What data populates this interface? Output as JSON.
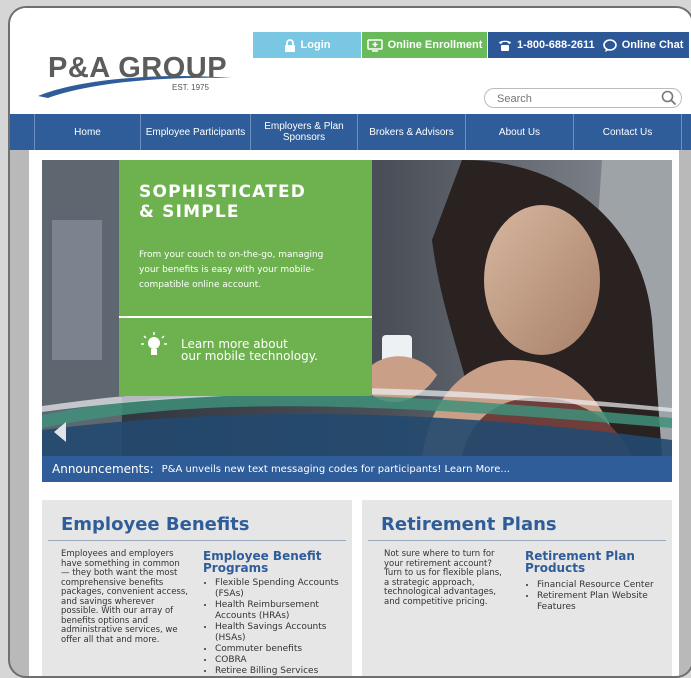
{
  "header": {
    "logo_text": "P&A GROUP",
    "logo_est": "EST. 1975",
    "login_label": "Login",
    "enroll_label": "Online Enrollment",
    "phone_label": "1-800-688-2611",
    "chat_label": "Online Chat",
    "search_placeholder": "Search"
  },
  "nav": {
    "items": [
      {
        "label": "Home"
      },
      {
        "label": "Employee Participants"
      },
      {
        "label": "Employers & Plan Sponsors"
      },
      {
        "label": "Brokers & Advisors"
      },
      {
        "label": "About Us"
      },
      {
        "label": "Contact Us"
      }
    ]
  },
  "hero": {
    "title": "SOPHISTICATED\n& SIMPLE",
    "body": "From your couch to on-the-go, managing your benefits is easy with your mobile-compatible online account.",
    "learn": "Learn more about\nour mobile technology."
  },
  "announcement": {
    "label": "Announcements:",
    "text": "P&A unveils new text messaging codes for participants! Learn More..."
  },
  "employee_benefits": {
    "title": "Employee Benefits",
    "description": "Employees and employers\nhave something in common\n— they both want the most\ncomprehensive benefits\npackages, convenient access,\nand savings wherever\npossible. With our array of\nbenefits options and\nadministrative services, we\noffer all that and more.",
    "subtitle": "Employee Benefit\nPrograms",
    "items": [
      "Flexible Spending Accounts (FSAs)",
      "Health Reimbursement Accounts (HRAs)",
      "Health Savings Accounts (HSAs)",
      "Commuter benefits",
      "COBRA",
      "Retiree Billing Services"
    ]
  },
  "retirement_plans": {
    "title": "Retirement Plans",
    "description": "Not sure where to turn for\nyour retirement account?\nTurn to us for flexible plans,\na strategic approach,\ntechnological advantages,\nand competitive pricing.",
    "subtitle": "Retirement Plan\nProducts",
    "items": [
      "Financial Resource Center",
      "Retirement Plan Website Features"
    ]
  },
  "colors": {
    "brand_blue": "#2f5d99",
    "green": "#6db24f",
    "login_blue": "#79c7e2",
    "enroll_green": "#69ba58"
  }
}
